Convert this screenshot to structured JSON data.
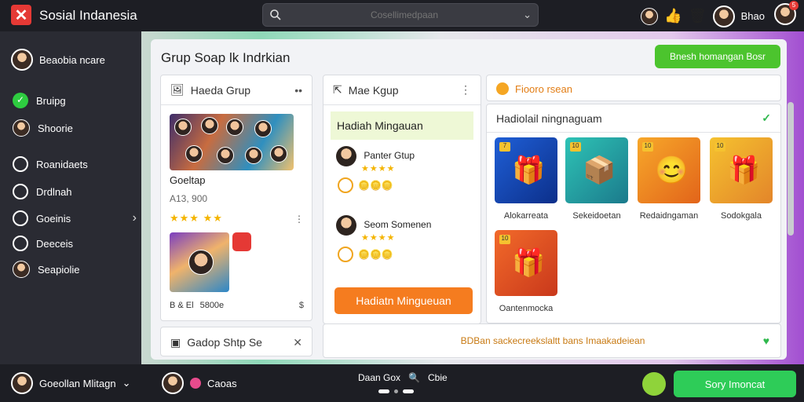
{
  "app": {
    "title": "Sosial Indanesia"
  },
  "search": {
    "placeholder": "Cosellimedpaan"
  },
  "topbar": {
    "user_name": "Bhao",
    "notif_count": "5"
  },
  "sidebar": {
    "user": "Beaobia ncare",
    "items": [
      {
        "label": "Bruipg",
        "icon": "check-circle-icon"
      },
      {
        "label": "Shoorie",
        "icon": "user-avatar-icon"
      },
      {
        "label": "Roanidaets",
        "icon": "circle-icon"
      },
      {
        "label": "Drdlnah",
        "icon": "circle-icon"
      },
      {
        "label": "Goeinis",
        "icon": "circle-icon"
      },
      {
        "label": "Deeceis",
        "icon": "circle-icon"
      },
      {
        "label": "Seapiolie",
        "icon": "user-avatar-icon"
      }
    ]
  },
  "main": {
    "title": "Grup Soap lk  Indrkian",
    "cta_top": "Bnesh homangan Bosr",
    "group_card": {
      "header": "Haeda Grup",
      "name": "Goeltap",
      "sub": "A13, 900",
      "stars": "★★★ ★★",
      "foot_left": "B & El",
      "foot_mid": "5800e",
      "foot_right": "$"
    },
    "group_card_b": {
      "header": "Gadop Shtp Se"
    },
    "mid_card": {
      "header": "Mae Kgup",
      "highlight": "Hadiah Mingauan",
      "person1": {
        "name": "Panter Gtup",
        "stars": "★★★★"
      },
      "person2": {
        "name": "Seom Somenen",
        "stars": "★★★★"
      },
      "cta": "Hadiatn Mingueuan"
    },
    "reward_header": "Fiooro rsean",
    "gift_card": {
      "header": "Hadiolail ningnaguam",
      "gifts": [
        {
          "label": "Alokarreata",
          "badge": "7",
          "glyph": "🎁"
        },
        {
          "label": "Sekeidoetan",
          "badge": "10",
          "glyph": "📦"
        },
        {
          "label": "Redaidngaman",
          "badge": "10",
          "glyph": "😊"
        },
        {
          "label": "Sodokgala",
          "badge": "10",
          "glyph": "🎁"
        },
        {
          "label": "Oantenmocka",
          "badge": "10",
          "glyph": "🎁"
        }
      ]
    },
    "bottom_notice": "BDBan sackecreekslaltt bans Imaakadeiean"
  },
  "bottombar": {
    "user": "Goeollan Mlitagn",
    "chat": "Caoas",
    "center_a": "Daan Gox",
    "center_b": "Cbie",
    "cta": "Sory Imoncat"
  }
}
